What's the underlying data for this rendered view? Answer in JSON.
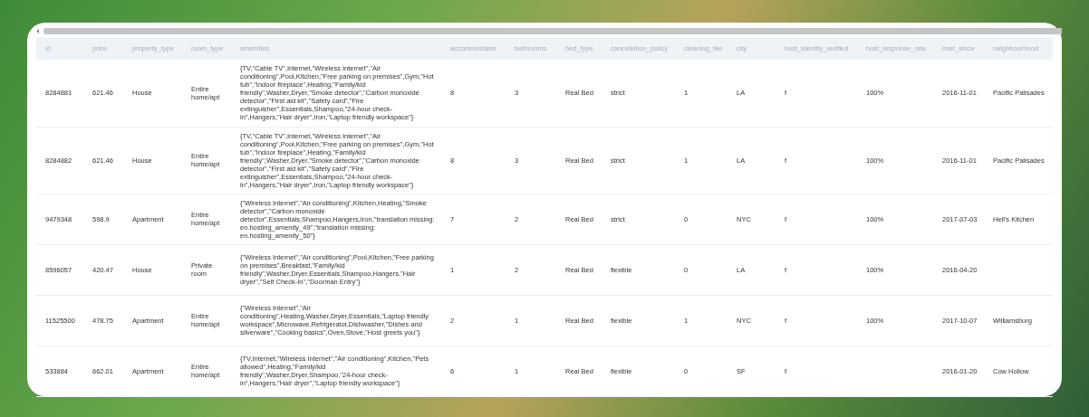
{
  "table": {
    "columns": [
      "id",
      "price",
      "property_type",
      "room_type",
      "amenities",
      "accommodates",
      "bathrooms",
      "bed_type",
      "cancellation_policy",
      "cleaning_fee",
      "city",
      "host_identity_verified",
      "host_response_rate",
      "host_since",
      "neighbourhood"
    ],
    "rows": [
      [
        "8284881",
        "621.46",
        "House",
        "Entire home/apt",
        "{TV,\"Cable TV\",Internet,\"Wireless Internet\",\"Air conditioning\",Pool,Kitchen,\"Free parking on premises\",Gym,\"Hot tub\",\"Indoor fireplace\",Heating,\"Family/kid friendly\",Washer,Dryer,\"Smoke detector\",\"Carbon monoxide detector\",\"First aid kit\",\"Safety card\",\"Fire extinguisher\",Essentials,Shampoo,\"24-hour check-in\",Hangers,\"Hair dryer\",Iron,\"Laptop friendly workspace\"}",
        "8",
        "3",
        "Real Bed",
        "strict",
        "1",
        "LA",
        "f",
        "100%",
        "2016-11-01",
        "Pacific Palisades"
      ],
      [
        "8284882",
        "621.46",
        "House",
        "Entire home/apt",
        "{TV,\"Cable TV\",Internet,\"Wireless Internet\",\"Air conditioning\",Pool,Kitchen,\"Free parking on premises\",Gym,\"Hot tub\",\"Indoor fireplace\",Heating,\"Family/kid friendly\",Washer,Dryer,\"Smoke detector\",\"Carbon monoxide detector\",\"First aid kit\",\"Safety card\",\"Fire extinguisher\",Essentials,Shampoo,\"24-hour check-in\",Hangers,\"Hair dryer\",Iron,\"Laptop friendly workspace\"}",
        "8",
        "3",
        "Real Bed",
        "strict",
        "1",
        "LA",
        "f",
        "100%",
        "2016-11-01",
        "Pacific Palisades"
      ],
      [
        "9479348",
        "598.9",
        "Apartment",
        "Entire home/apt",
        "{\"Wireless Internet\",\"Air conditioning\",Kitchen,Heating,\"Smoke detector\",\"Carbon monoxide detector\",Essentials,Shampoo,Hangers,Iron,\"translation missing: en.hosting_amenity_49\",\"translation missing: en.hosting_amenity_50\"}",
        "7",
        "2",
        "Real Bed",
        "strict",
        "0",
        "NYC",
        "f",
        "100%",
        "2017-07-03",
        "Hell's Kitchen"
      ],
      [
        "8596057",
        "420.47",
        "House",
        "Private room",
        "{\"Wireless Internet\",\"Air conditioning\",Pool,Kitchen,\"Free parking on premises\",Breakfast,\"Family/kid friendly\",Washer,Dryer,Essentials,Shampoo,Hangers,\"Hair dryer\",\"Self Check-In\",\"Doorman Entry\"}",
        "1",
        "2",
        "Real Bed",
        "flexible",
        "0",
        "LA",
        "f",
        "100%",
        "2016-04-20",
        null
      ],
      [
        "11525500",
        "478.75",
        "Apartment",
        "Entire home/apt",
        "{\"Wireless Internet\",\"Air conditioning\",Heating,Washer,Dryer,Essentials,\"Laptop friendly workspace\",Microwave,Refrigerator,Dishwasher,\"Dishes and silverware\",\"Cooking basics\",Oven,Stove,\"Host greets you\"}",
        "2",
        "1",
        "Real Bed",
        "flexible",
        "1",
        "NYC",
        "f",
        "100%",
        "2017-10-07",
        "Williamsburg"
      ],
      [
        "533884",
        "662.01",
        "Apartment",
        "Entire home/apt",
        "{TV,Internet,\"Wireless Internet\",\"Air conditioning\",Kitchen,\"Pets allowed\",Heating,\"Family/kid friendly\",Washer,Dryer,Shampoo,\"24-hour check-in\",Hangers,\"Hair dryer\",\"Laptop friendly workspace\"}",
        "6",
        "1",
        "Real Bed",
        "flexible",
        "0",
        "SF",
        "f",
        null,
        "2016-01-20",
        "Cow Hollow"
      ]
    ]
  }
}
